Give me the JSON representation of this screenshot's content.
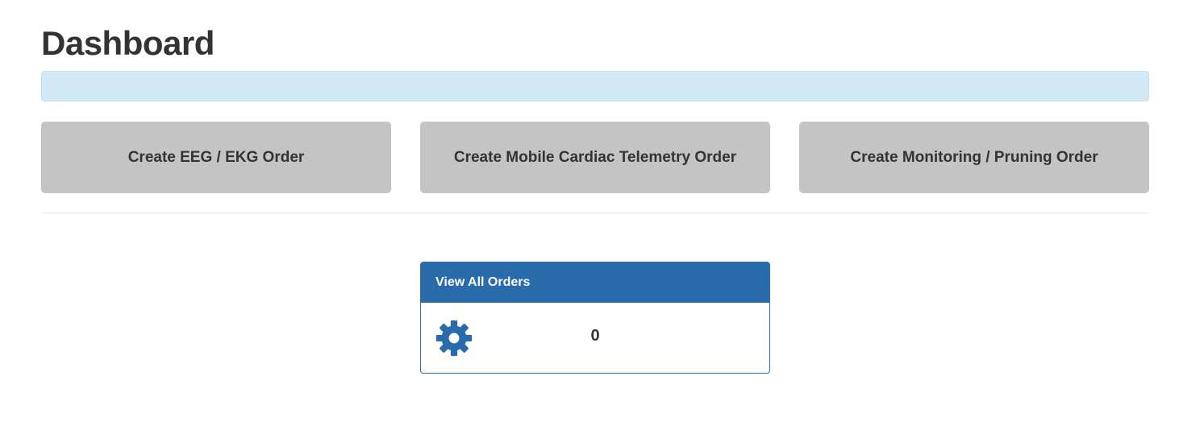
{
  "page": {
    "title": "Dashboard",
    "alert_text": ""
  },
  "actions": [
    {
      "label": "Create EEG / EKG Order"
    },
    {
      "label": "Create Mobile Cardiac Telemetry Order"
    },
    {
      "label": "Create Monitoring / Pruning Order"
    }
  ],
  "orders_panel": {
    "heading": "View All Orders",
    "icon": "gear-icon",
    "count": "0"
  },
  "colors": {
    "accent": "#2a6cab",
    "button_bg": "#c4c4c4",
    "alert_bg": "#d3e9f5"
  }
}
